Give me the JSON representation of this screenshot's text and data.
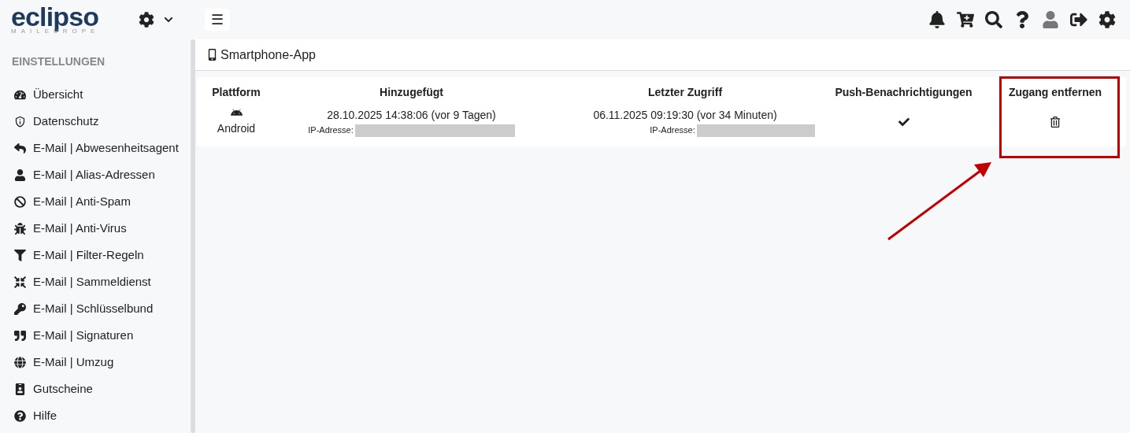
{
  "logo": {
    "wordmark": "eclipso",
    "tagline": "MAILEUROPE"
  },
  "menu_button": "☰",
  "sidebar": {
    "heading": "EINSTELLUNGEN",
    "items": [
      {
        "label": "Übersicht"
      },
      {
        "label": "Datenschutz"
      },
      {
        "label": "E-Mail | Abwesenheitsagent"
      },
      {
        "label": "E-Mail | Alias-Adressen"
      },
      {
        "label": "E-Mail | Anti-Spam"
      },
      {
        "label": "E-Mail | Anti-Virus"
      },
      {
        "label": "E-Mail | Filter-Regeln"
      },
      {
        "label": "E-Mail | Sammeldienst"
      },
      {
        "label": "E-Mail | Schlüsselbund"
      },
      {
        "label": "E-Mail | Signaturen"
      },
      {
        "label": "E-Mail | Umzug"
      },
      {
        "label": "Gutscheine"
      },
      {
        "label": "Hilfe"
      }
    ]
  },
  "page": {
    "title": "Smartphone-App"
  },
  "table": {
    "columns": [
      "Plattform",
      "Hinzugefügt",
      "Letzter Zugriff",
      "Push-Benachrichtigungen",
      "Zugang entfernen"
    ],
    "rows": [
      {
        "platform": "Android",
        "added": "28.10.2025 14:38:06 (vor 9 Tagen)",
        "added_ip_label": "IP-Adresse:",
        "last_access": "06.11.2025 09:19:30 (vor 34 Minuten)",
        "last_ip_label": "IP-Adresse:",
        "push": true
      }
    ]
  }
}
